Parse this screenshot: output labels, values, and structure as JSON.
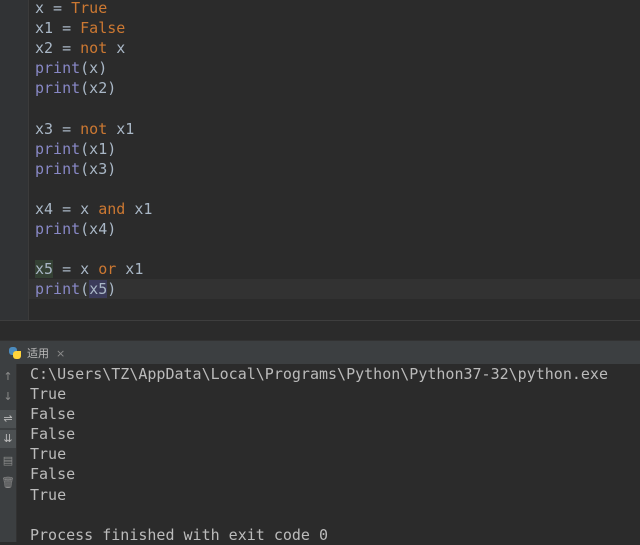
{
  "editor": {
    "lines": [
      {
        "tokens": [
          {
            "t": "x = ",
            "c": ""
          },
          {
            "t": "True",
            "c": "const"
          }
        ]
      },
      {
        "tokens": [
          {
            "t": "x1 = ",
            "c": ""
          },
          {
            "t": "False",
            "c": "const"
          }
        ]
      },
      {
        "tokens": [
          {
            "t": "x2 = ",
            "c": ""
          },
          {
            "t": "not",
            "c": "kw"
          },
          {
            "t": " x",
            "c": ""
          }
        ]
      },
      {
        "tokens": [
          {
            "t": "print",
            "c": "bi"
          },
          {
            "t": "(x)",
            "c": ""
          }
        ]
      },
      {
        "tokens": [
          {
            "t": "print",
            "c": "bi"
          },
          {
            "t": "(x2)",
            "c": ""
          }
        ]
      },
      {
        "tokens": []
      },
      {
        "tokens": [
          {
            "t": "x3 = ",
            "c": ""
          },
          {
            "t": "not",
            "c": "kw"
          },
          {
            "t": " x1",
            "c": ""
          }
        ]
      },
      {
        "tokens": [
          {
            "t": "print",
            "c": "bi"
          },
          {
            "t": "(x1)",
            "c": ""
          }
        ]
      },
      {
        "tokens": [
          {
            "t": "print",
            "c": "bi"
          },
          {
            "t": "(x3)",
            "c": ""
          }
        ]
      },
      {
        "tokens": []
      },
      {
        "tokens": [
          {
            "t": "x4 = x ",
            "c": ""
          },
          {
            "t": "and",
            "c": "kw"
          },
          {
            "t": " x1",
            "c": ""
          }
        ]
      },
      {
        "tokens": [
          {
            "t": "print",
            "c": "bi"
          },
          {
            "t": "(x4)",
            "c": ""
          }
        ]
      },
      {
        "tokens": []
      },
      {
        "tokens": [
          {
            "t": "x5",
            "c": "hl"
          },
          {
            "t": " = x ",
            "c": ""
          },
          {
            "t": "or",
            "c": "kw"
          },
          {
            "t": " x1",
            "c": ""
          }
        ]
      },
      {
        "tokens": [
          {
            "t": "print",
            "c": "bi"
          },
          {
            "t": "(",
            "c": ""
          },
          {
            "t": "x5",
            "c": "hl2"
          },
          {
            "t": ")",
            "c": ""
          }
        ]
      }
    ]
  },
  "run_panel": {
    "tab_label": "适用",
    "close_label": "×",
    "toolbar_icons": [
      {
        "name": "up-arrow-icon",
        "glyph": "↑"
      },
      {
        "name": "down-arrow-icon",
        "glyph": "↓"
      },
      {
        "name": "soft-wrap-icon",
        "glyph": "⇌"
      },
      {
        "name": "scroll-to-end-icon",
        "glyph": "⇊"
      },
      {
        "name": "print-icon",
        "glyph": "▤"
      },
      {
        "name": "trash-icon",
        "glyph": "🗑"
      }
    ],
    "output_lines": [
      "C:\\Users\\TZ\\AppData\\Local\\Programs\\Python\\Python37-32\\python.exe",
      "True",
      "False",
      "False",
      "True",
      "False",
      "True",
      "",
      "Process finished with exit code 0"
    ]
  }
}
